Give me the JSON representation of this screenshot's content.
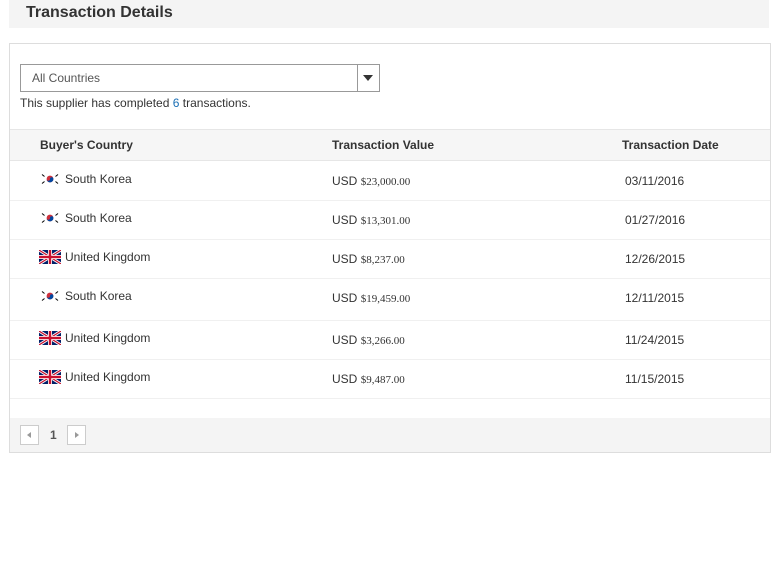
{
  "header": {
    "title": "Transaction Details"
  },
  "filter": {
    "selected": "All Countries"
  },
  "summary": {
    "prefix": "This supplier has completed",
    "count": "6",
    "suffix": "transactions."
  },
  "table": {
    "columns": [
      "Buyer's Country",
      "Transaction Value",
      "Transaction Date"
    ],
    "rows": [
      {
        "flag": "south-korea-flag",
        "country": "South Korea",
        "currency": "USD",
        "amount": "$23,000.00",
        "date": "03/11/2016"
      },
      {
        "flag": "south-korea-flag",
        "country": "South Korea",
        "currency": "USD",
        "amount": "$13,301.00",
        "date": "01/27/2016"
      },
      {
        "flag": "uk-flag",
        "country": "United Kingdom",
        "currency": "USD",
        "amount": "$8,237.00",
        "date": "12/26/2015"
      },
      {
        "flag": "south-korea-flag",
        "country": "South Korea",
        "currency": "USD",
        "amount": "$19,459.00",
        "date": "12/11/2015"
      },
      {
        "flag": "uk-flag",
        "country": "United Kingdom",
        "currency": "USD",
        "amount": "$3,266.00",
        "date": "11/24/2015"
      },
      {
        "flag": "uk-flag",
        "country": "United Kingdom",
        "currency": "USD",
        "amount": "$9,487.00",
        "date": "11/15/2015"
      }
    ]
  },
  "pagination": {
    "current_page": "1"
  }
}
